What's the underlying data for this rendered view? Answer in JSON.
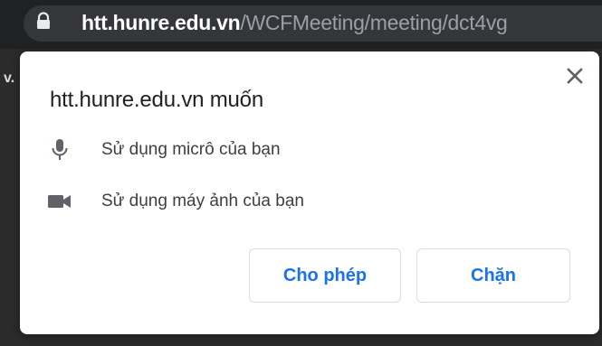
{
  "browser": {
    "url_host": "htt.hunre.edu.vn",
    "url_path": "/WCFMeeting/meeting/dct4vg",
    "lock_icon": "lock-icon"
  },
  "page": {
    "edge_text": "v."
  },
  "permission_dialog": {
    "title": "htt.hunre.edu.vn muốn",
    "close_icon": "close-icon",
    "permissions": [
      {
        "icon": "microphone-icon",
        "label": "Sử dụng micrô của bạn"
      },
      {
        "icon": "camera-icon",
        "label": "Sử dụng máy ảnh của bạn"
      }
    ],
    "allow_label": "Cho phép",
    "block_label": "Chặn"
  },
  "colors": {
    "accent": "#1a73e8",
    "toolbar_bg": "#202124",
    "omnibox_bg": "#35363a",
    "icon_gray": "#5f6368"
  }
}
